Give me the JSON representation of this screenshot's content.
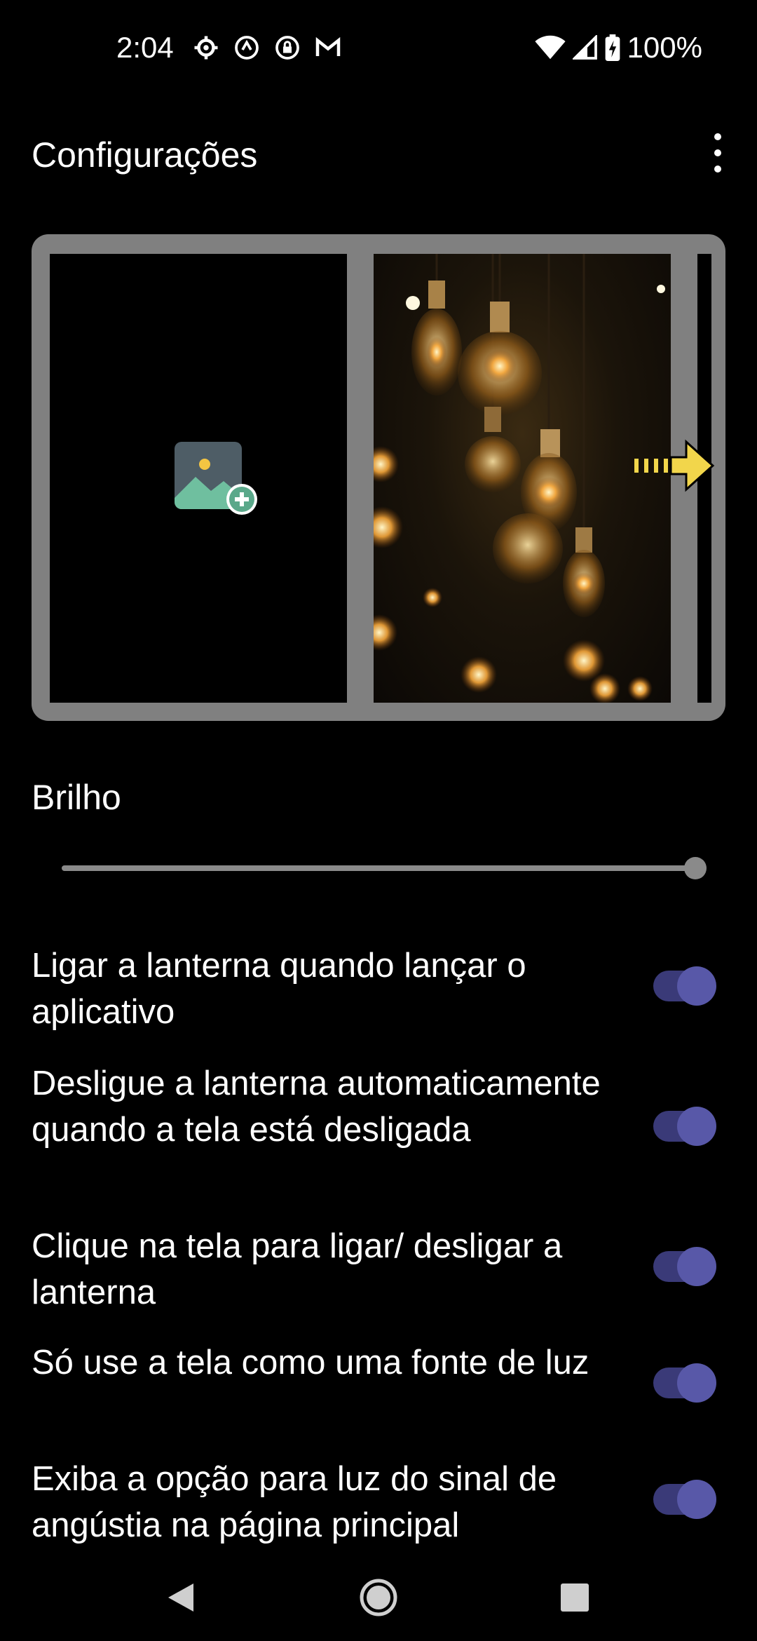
{
  "status_bar": {
    "time": "2:04",
    "battery": "100%",
    "icons_left": [
      "settings-gear-icon",
      "vpn-icon",
      "lock-icon",
      "gmail-icon"
    ],
    "icons_right": [
      "wifi-icon",
      "signal-icon",
      "battery-charging-icon"
    ]
  },
  "app_bar": {
    "title": "Configurações",
    "menu_icon": "more-vert-icon"
  },
  "gallery": {
    "add_icon": "add-image-icon",
    "photo_description_icon": "light-bulbs-photo",
    "next_icon": "arrow-right-icon"
  },
  "brightness": {
    "label": "Brilho",
    "value": 1.0
  },
  "settings": [
    {
      "label": "Ligar a lanterna quando lançar o aplicativo",
      "enabled": true
    },
    {
      "label": "Desligue a lanterna automaticamente quando a tela está desligada",
      "enabled": true
    },
    {
      "label": "Clique na tela para ligar/ desligar a lanterna",
      "enabled": true
    },
    {
      "label": "Só use a tela como uma fonte de luz",
      "enabled": true
    },
    {
      "label": "Exiba a opção para luz do sinal de angústia na página principal",
      "enabled": true
    }
  ],
  "nav_bar": {
    "back_icon": "back-triangle-icon",
    "home_icon": "home-circle-icon",
    "recents_icon": "recents-square-icon"
  },
  "colors": {
    "background": "#000000",
    "toggle_track": "#3a3a78",
    "toggle_thumb": "#5858a8",
    "gallery_frame": "#808080"
  }
}
